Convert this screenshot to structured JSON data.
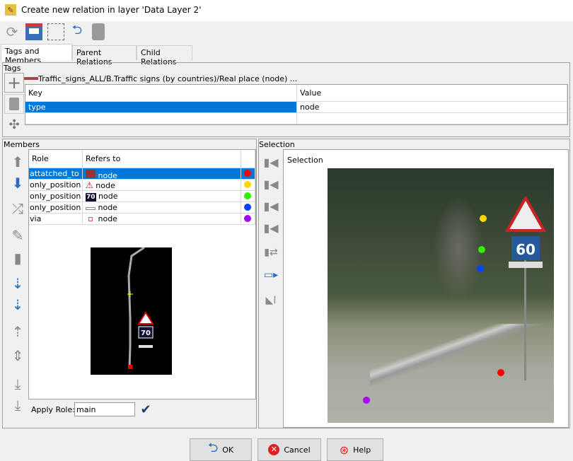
{
  "window": {
    "title": "Create new relation in layer 'Data Layer 2'"
  },
  "toolbar": {
    "icons": [
      "refresh-icon",
      "save-icon",
      "select-icon",
      "zoom-to-icon",
      "delete-icon"
    ]
  },
  "tabs": [
    {
      "label": "Tags and Members"
    },
    {
      "label": "Parent Relations"
    },
    {
      "label": "Child Relations"
    }
  ],
  "tags": {
    "section_label": "Tags",
    "preset_path": "Traffic_signs_ALL/B.Traffic signs (by countries)/Real place (node) ...",
    "columns": [
      "Key",
      "Value"
    ],
    "rows": [
      {
        "key": "type",
        "value": "node"
      }
    ]
  },
  "members": {
    "section_label": "Members",
    "columns": [
      "Role",
      "Refers to"
    ],
    "rows": [
      {
        "role": "attatched_to",
        "refers": "node",
        "color": "#ff0000",
        "icon": "sign-post-icon"
      },
      {
        "role": "only_position",
        "refers": "node",
        "color": "#ffd700",
        "icon": "warning-sign-icon"
      },
      {
        "role": "only_position",
        "refers": "node",
        "color": "#33ee00",
        "icon": "speed-70-icon"
      },
      {
        "role": "only_position",
        "refers": "node",
        "color": "#0044ff",
        "icon": "plate-icon"
      },
      {
        "role": "via",
        "refers": "node",
        "color": "#aa00ff",
        "icon": "node-icon"
      }
    ],
    "map_sign_text": "70",
    "apply_role_label": "Apply Role:",
    "apply_role_value": "main"
  },
  "selection": {
    "section_label": "Selection",
    "list_header": "Selection",
    "photo_sign_text": "60"
  },
  "buttons": {
    "ok": "OK",
    "cancel": "Cancel",
    "help": "Help"
  }
}
